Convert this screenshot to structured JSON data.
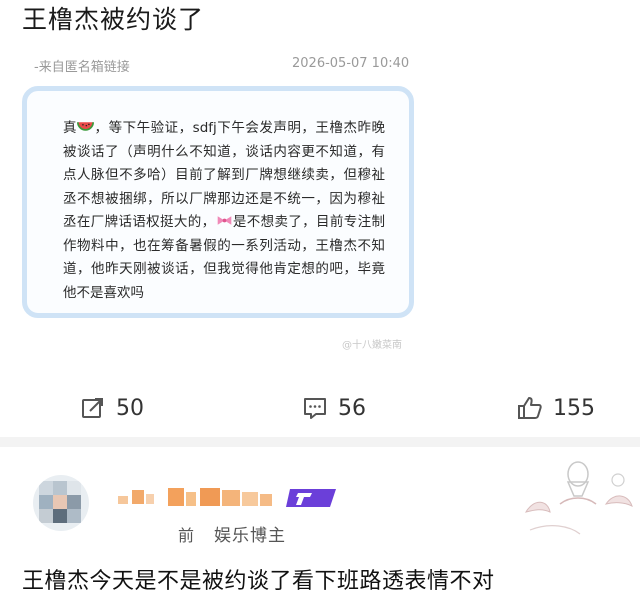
{
  "post": {
    "title": "王橹杰被约谈了",
    "source": "-来自匿名箱链接",
    "timestamp": "2026-05-07 10:40",
    "card_text_before_emoji": "真",
    "card_text_after_emoji": "，等下午验证，sdfj下午会发声明，王橹杰昨晚被谈话了（声明什么不知道，谈话内容更不知道，有点人脉但不多哈）目前了解到厂牌想继续卖，但穆祉丞不想被捆绑，所以厂牌那边还是不统一，因为穆祉丞在厂牌话语权挺大的，",
    "card_text_after_bow": "是不想卖了，目前专注制作物料中，也在筹备暑假的一系列活动，王橹杰不知道，他昨天刚被谈话，但我觉得他肯定想的吧，毕竟他不是喜欢吗",
    "emoji_1": "watermelon-icon",
    "emoji_2": "bow-icon",
    "watermark": "@十八嫩菜南"
  },
  "actions": {
    "repost_count": "50",
    "comment_count": "56",
    "like_count": "155"
  },
  "comment": {
    "user_prefix": "前",
    "user_tag": "娱乐博主",
    "text": "王橹杰今天是不是被约谈了看下班路透表情不对"
  },
  "colors": {
    "card_border": "#cfe3f6",
    "vip_badge": "#6b3fd9",
    "icon_gray": "#555555"
  }
}
